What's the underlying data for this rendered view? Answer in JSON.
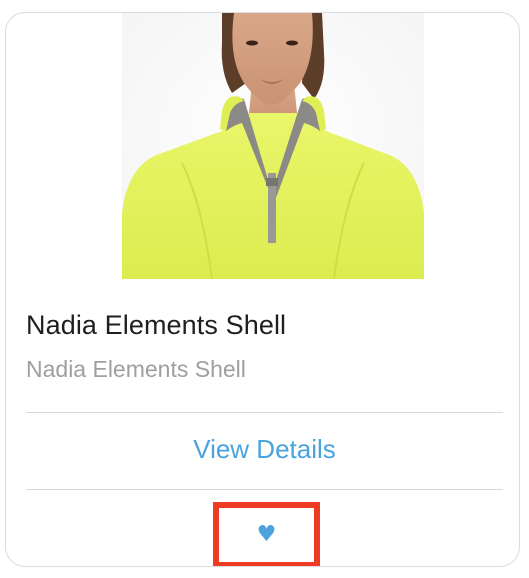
{
  "product": {
    "name": "Nadia Elements Shell",
    "subtitle": "Nadia Elements Shell"
  },
  "actions": {
    "view_details_label": "View Details",
    "wishlist_icon": "♥"
  },
  "colors": {
    "accent": "#4aa3dc",
    "highlight_box": "#ee3b24",
    "jacket": "#e4f35a"
  }
}
